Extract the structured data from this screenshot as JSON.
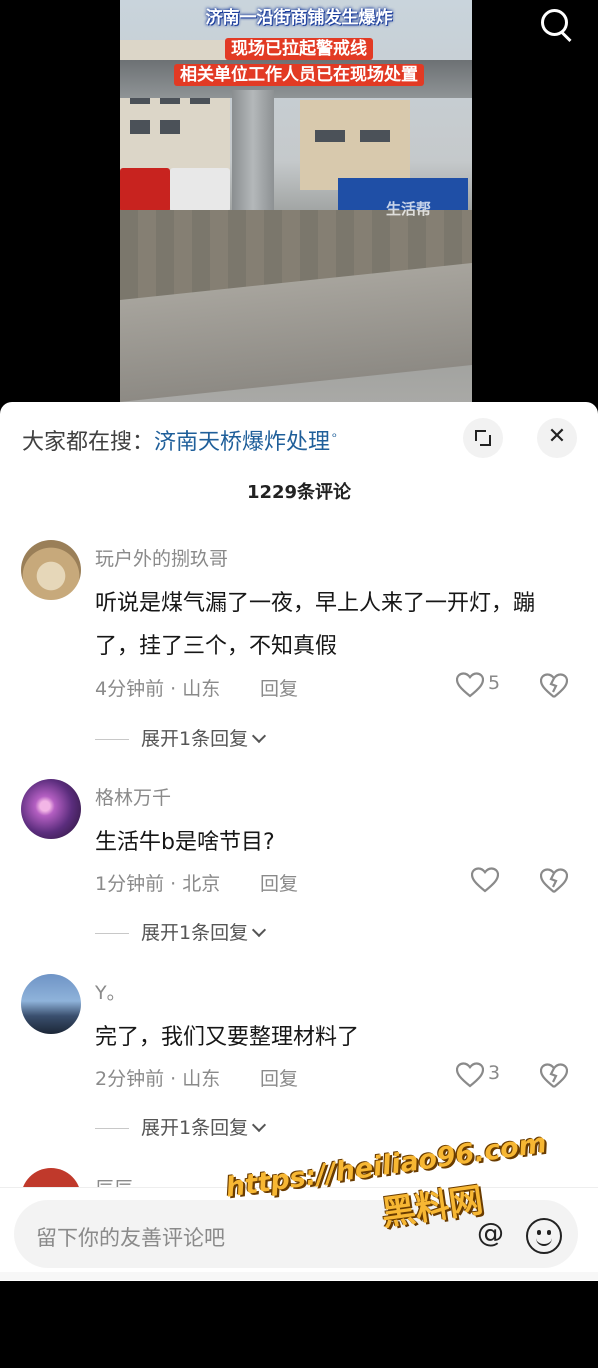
{
  "video": {
    "overlay_line1": "济南一沿街商铺发生爆炸",
    "overlay_line2": "现场已拉起警戒线",
    "overlay_line3": "相关单位工作人员已在现场处置",
    "watermark": "生活帮"
  },
  "header": {
    "hot_search_label": "大家都在搜：",
    "hot_search_link": "济南天桥爆炸处理",
    "search_glyph": "ᵒ"
  },
  "comment_count": "1229条评论",
  "comments": [
    {
      "user": "玩户外的捌玖哥",
      "text": "听说是煤气漏了一夜，早上人来了一开灯，蹦了，挂了三个，不知真假",
      "meta": "4分钟前 · 山东",
      "reply": "回复",
      "likes": "5",
      "expand": "展开1条回复"
    },
    {
      "user": "格林万千",
      "text": "生活牛b是啥节目?",
      "meta": "1分钟前 · 北京",
      "reply": "回复",
      "likes": "",
      "expand": "展开1条回复"
    },
    {
      "user": "Y。",
      "text": "完了，我们又要整理材料了",
      "meta": "2分钟前 · 山东",
      "reply": "回复",
      "likes": "3",
      "expand": "展开1条回复"
    },
    {
      "user": "辰辰"
    }
  ],
  "input": {
    "placeholder": "留下你的友善评论吧",
    "at_symbol": "@"
  },
  "site_watermark": {
    "url": "https://heiliao96.com",
    "name": "黑料网"
  },
  "colors": {
    "link_blue": "#1f5f9a",
    "overlay_red": "#e23a24",
    "watermark_orange": "#f7b733"
  }
}
